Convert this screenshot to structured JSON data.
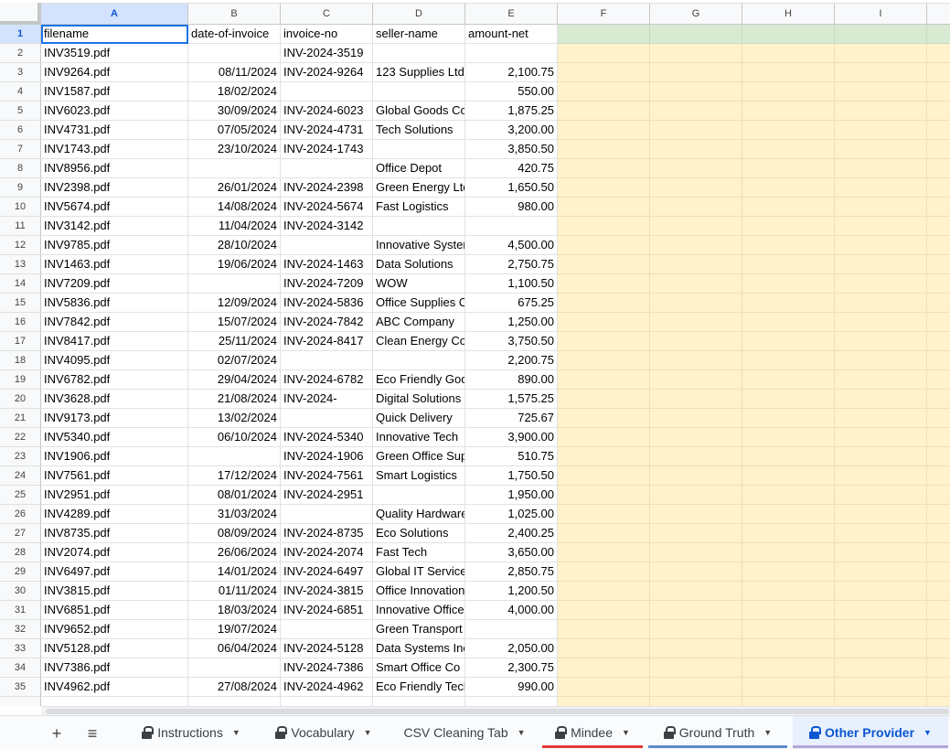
{
  "columns": [
    "A",
    "B",
    "C",
    "D",
    "E",
    "F",
    "G",
    "H",
    "I"
  ],
  "rows": [
    {
      "n": "1",
      "a": "filename",
      "b": "date-of-invoice",
      "c": "invoice-no",
      "d": "seller-name",
      "e": "amount-net"
    },
    {
      "n": "2",
      "a": "INV3519.pdf",
      "b": "",
      "c": "INV-2024-3519",
      "d": "",
      "e": ""
    },
    {
      "n": "3",
      "a": "INV9264.pdf",
      "b": "08/11/2024",
      "c": "INV-2024-9264",
      "d": "123 Supplies Ltd",
      "e": "2,100.75"
    },
    {
      "n": "4",
      "a": "INV1587.pdf",
      "b": "18/02/2024",
      "c": "",
      "d": "",
      "e": "550.00"
    },
    {
      "n": "5",
      "a": "INV6023.pdf",
      "b": "30/09/2024",
      "c": "INV-2024-6023",
      "d": "Global Goods Co",
      "e": "1,875.25"
    },
    {
      "n": "6",
      "a": "INV4731.pdf",
      "b": "07/05/2024",
      "c": "INV-2024-4731",
      "d": "Tech Solutions",
      "e": "3,200.00"
    },
    {
      "n": "7",
      "a": "INV1743.pdf",
      "b": "23/10/2024",
      "c": "INV-2024-1743",
      "d": "",
      "e": "3,850.50"
    },
    {
      "n": "8",
      "a": "INV8956.pdf",
      "b": "",
      "c": "",
      "d": "Office Depot",
      "e": "420.75"
    },
    {
      "n": "9",
      "a": "INV2398.pdf",
      "b": "26/01/2024",
      "c": "INV-2024-2398",
      "d": "Green Energy Ltd",
      "e": "1,650.50"
    },
    {
      "n": "10",
      "a": "INV5674.pdf",
      "b": "14/08/2024",
      "c": "INV-2024-5674",
      "d": "Fast Logistics",
      "e": "980.00"
    },
    {
      "n": "11",
      "a": "INV3142.pdf",
      "b": "11/04/2024",
      "c": "INV-2024-3142",
      "d": "",
      "e": ""
    },
    {
      "n": "12",
      "a": "INV9785.pdf",
      "b": "28/10/2024",
      "c": "",
      "d": "Innovative Systems",
      "e": "4,500.00"
    },
    {
      "n": "13",
      "a": "INV1463.pdf",
      "b": "19/06/2024",
      "c": "INV-2024-1463",
      "d": "Data Solutions",
      "e": "2,750.75"
    },
    {
      "n": "14",
      "a": "INV7209.pdf",
      "b": "",
      "c": "INV-2024-7209",
      "d": "WOW",
      "e": "1,100.50"
    },
    {
      "n": "15",
      "a": "INV5836.pdf",
      "b": "12/09/2024",
      "c": "INV-2024-5836",
      "d": "Office Supplies Co",
      "e": "675.25"
    },
    {
      "n": "16",
      "a": "INV7842.pdf",
      "b": "15/07/2024",
      "c": "INV-2024-7842",
      "d": "ABC Company",
      "e": "1,250.00"
    },
    {
      "n": "17",
      "a": "INV8417.pdf",
      "b": "25/11/2024",
      "c": "INV-2024-8417",
      "d": "Clean Energy Co",
      "e": "3,750.50"
    },
    {
      "n": "18",
      "a": "INV4095.pdf",
      "b": "02/07/2024",
      "c": "",
      "d": "",
      "e": "2,200.75"
    },
    {
      "n": "19",
      "a": "INV6782.pdf",
      "b": "29/04/2024",
      "c": "INV-2024-6782",
      "d": "Eco Friendly Goods",
      "e": "890.00"
    },
    {
      "n": "20",
      "a": "INV3628.pdf",
      "b": "21/08/2024",
      "c": "INV-2024-",
      "d": "Digital Solutions",
      "e": "1,575.25"
    },
    {
      "n": "21",
      "a": "INV9173.pdf",
      "b": "13/02/2024",
      "c": "",
      "d": "Quick Delivery",
      "e": "725.67"
    },
    {
      "n": "22",
      "a": "INV5340.pdf",
      "b": "06/10/2024",
      "c": "INV-2024-5340",
      "d": "Innovative Tech",
      "e": "3,900.00"
    },
    {
      "n": "23",
      "a": "INV1906.pdf",
      "b": "",
      "c": "INV-2024-1906",
      "d": "Green Office Supplies",
      "e": "510.75"
    },
    {
      "n": "24",
      "a": "INV7561.pdf",
      "b": "17/12/2024",
      "c": "INV-2024-7561",
      "d": "Smart Logistics",
      "e": "1,750.50"
    },
    {
      "n": "25",
      "a": "INV2951.pdf",
      "b": "08/01/2024",
      "c": "INV-2024-2951",
      "d": "",
      "e": "1,950.00"
    },
    {
      "n": "26",
      "a": "INV4289.pdf",
      "b": "31/03/2024",
      "c": "",
      "d": "Quality Hardware",
      "e": "1,025.00"
    },
    {
      "n": "27",
      "a": "INV8735.pdf",
      "b": "08/09/2024",
      "c": "INV-2024-8735",
      "d": "Eco Solutions",
      "e": "2,400.25"
    },
    {
      "n": "28",
      "a": "INV2074.pdf",
      "b": "26/06/2024",
      "c": "INV-2024-2074",
      "d": "Fast Tech",
      "e": "3,650.00"
    },
    {
      "n": "29",
      "a": "INV6497.pdf",
      "b": "14/01/2024",
      "c": "INV-2024-6497",
      "d": "Global IT Services",
      "e": "2,850.75"
    },
    {
      "n": "30",
      "a": "INV3815.pdf",
      "b": "01/11/2024",
      "c": "INV-2024-3815",
      "d": "Office Innovations",
      "e": "1,200.50"
    },
    {
      "n": "31",
      "a": "INV6851.pdf",
      "b": "18/03/2024",
      "c": "INV-2024-6851",
      "d": "Innovative Office",
      "e": "4,000.00"
    },
    {
      "n": "32",
      "a": "INV9652.pdf",
      "b": "19/07/2024",
      "c": "",
      "d": "Green Transport",
      "e": ""
    },
    {
      "n": "33",
      "a": "INV5128.pdf",
      "b": "06/04/2024",
      "c": "INV-2024-5128",
      "d": "Data Systems Inc",
      "e": "2,050.00"
    },
    {
      "n": "34",
      "a": "INV7386.pdf",
      "b": "",
      "c": "INV-2024-7386",
      "d": "Smart Office Co",
      "e": "2,300.75"
    },
    {
      "n": "35",
      "a": "INV4962.pdf",
      "b": "27/08/2024",
      "c": "INV-2024-4962",
      "d": "Eco Friendly Tech",
      "e": "990.00"
    }
  ],
  "toolbar": {
    "add_sheet": "+",
    "all_sheets": "≡"
  },
  "tabs": [
    {
      "label": "Instructions",
      "locked": true,
      "active": false,
      "underline": ""
    },
    {
      "label": "Vocabulary",
      "locked": true,
      "active": false,
      "underline": ""
    },
    {
      "label": "CSV Cleaning Tab",
      "locked": false,
      "active": false,
      "underline": ""
    },
    {
      "label": "Mindee",
      "locked": true,
      "active": false,
      "underline": "#e53935"
    },
    {
      "label": "Ground Truth",
      "locked": true,
      "active": false,
      "underline": "#5b8ec9"
    },
    {
      "label": "Other Provider",
      "locked": true,
      "active": true,
      "underline": "#b4a7d6"
    }
  ],
  "colors": {
    "yellow_fill": "#fff2cc",
    "green_fill": "#d9ead3",
    "active_tab": "#0b57d0"
  }
}
